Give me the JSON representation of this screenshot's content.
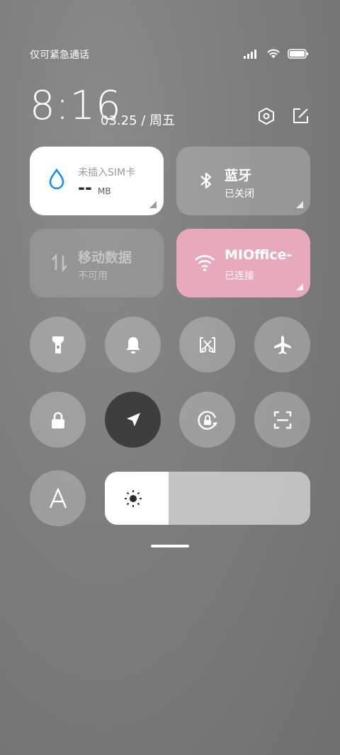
{
  "status": {
    "carrier_text": "仅可紧急通话"
  },
  "header": {
    "time": "8:16",
    "date": "03.25 / 周五"
  },
  "tiles": {
    "data": {
      "title": "未插入SIM卡",
      "value": "--",
      "unit": "MB"
    },
    "bluetooth": {
      "title": "蓝牙",
      "subtitle": "已关闭"
    },
    "mobile": {
      "title": "移动数据",
      "subtitle": "不可用"
    },
    "wifi": {
      "title": "MIOffice-",
      "subtitle": "已连接"
    }
  },
  "toggles_row1": [
    "flashlight-icon",
    "bell-icon",
    "screenshot-icon",
    "airplane-icon"
  ],
  "toggles_row2": [
    "lock-icon",
    "location-icon",
    "rotation-lock-icon",
    "scan-icon"
  ],
  "brightness": {
    "level": 0.31
  },
  "colors": {
    "accent_blue": "#1d8fe8",
    "wifi_pink": "#e8a9bd",
    "location_active": "#3e3e3e"
  }
}
